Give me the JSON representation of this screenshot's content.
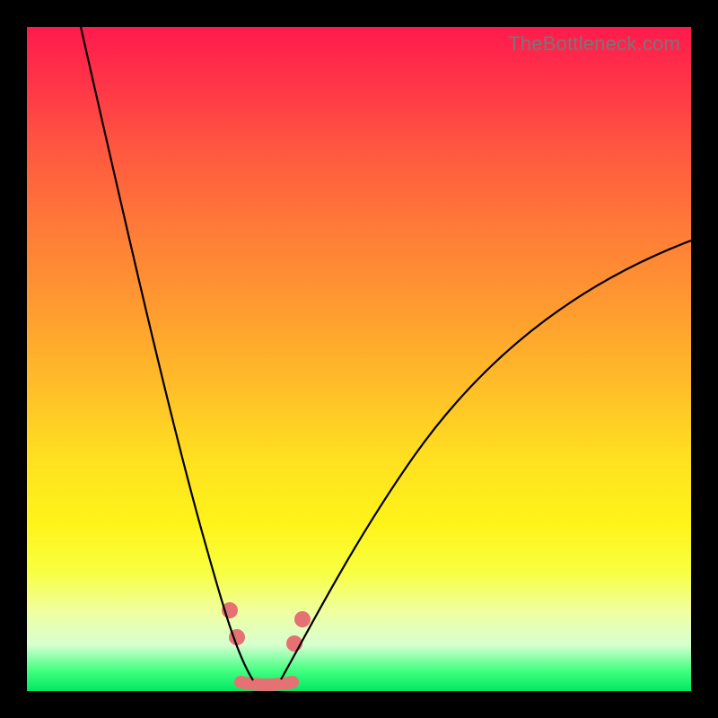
{
  "watermark": "TheBottleneck.com",
  "colors": {
    "frame": "#000000",
    "fit_stroke": "#e47273",
    "dot_fill": "#e47273",
    "line_stroke": "#000000"
  },
  "chart_data": {
    "type": "line",
    "title": "",
    "xlabel": "",
    "ylabel": "",
    "xlim": [
      0,
      100
    ],
    "ylim": [
      0,
      100
    ],
    "series": [
      {
        "name": "left-curve",
        "x": [
          8,
          10,
          12,
          14,
          16,
          18,
          20,
          22,
          24,
          26,
          27,
          28,
          29,
          30,
          31,
          32,
          33,
          34
        ],
        "y": [
          100,
          92,
          84,
          76,
          68,
          60,
          52,
          44,
          36,
          28,
          24,
          20,
          16,
          12,
          9,
          6,
          3.5,
          1.5
        ]
      },
      {
        "name": "right-curve",
        "x": [
          38,
          40,
          43,
          47,
          52,
          58,
          65,
          73,
          82,
          92,
          100
        ],
        "y": [
          1.5,
          3,
          6,
          11,
          18,
          26,
          35,
          44,
          53,
          62,
          68
        ]
      },
      {
        "name": "floor-fit",
        "x": [
          32,
          40
        ],
        "y": [
          0.8,
          0.8
        ]
      }
    ],
    "points": [
      {
        "name": "p-left-upper",
        "x": 30.6,
        "y": 12
      },
      {
        "name": "p-left-lower",
        "x": 31.6,
        "y": 8
      },
      {
        "name": "p-right-lower",
        "x": 40.0,
        "y": 7
      },
      {
        "name": "p-right-upper",
        "x": 41.3,
        "y": 11
      }
    ]
  }
}
